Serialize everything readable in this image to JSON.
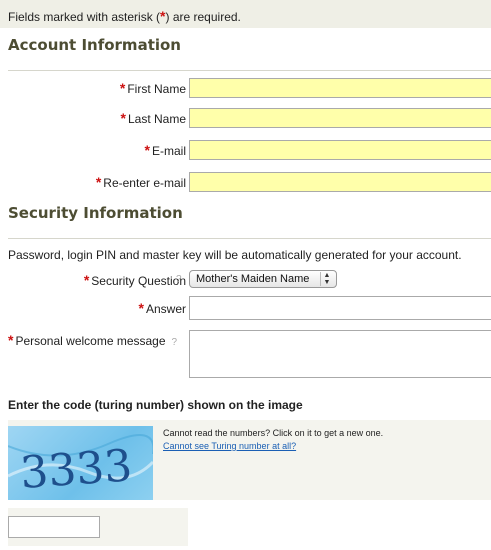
{
  "notice": {
    "before": "Fields marked with asterisk (",
    "asterisk": "*",
    "after": ") are required."
  },
  "account": {
    "title": "Account Information",
    "fields": [
      {
        "label": "First Name",
        "value": ""
      },
      {
        "label": "Last Name",
        "value": ""
      },
      {
        "label": "E-mail",
        "value": ""
      },
      {
        "label": "Re-enter e-mail",
        "value": ""
      }
    ]
  },
  "security": {
    "title": "Security Information",
    "info": "Password, login PIN and master key will be automatically generated for your account.",
    "question_label": "Security Question",
    "question_help": "?",
    "question_value": "Mother's Maiden Name",
    "answer_label": "Answer",
    "answer_value": "",
    "welcome_label": "Personal welcome message",
    "welcome_help": "?",
    "welcome_value": ""
  },
  "turing": {
    "title": "Enter the code (turing number) shown on the image",
    "captcha_text": "3333",
    "hint": "Cannot read the numbers? Click on it to get a new one.",
    "link": "Cannot see Turing number at all?",
    "code_value": ""
  },
  "colors": {
    "required": "#cc1111",
    "input_highlight": "#ffffaa",
    "section_title": "#4d4d33",
    "link": "#1a5fb4"
  }
}
